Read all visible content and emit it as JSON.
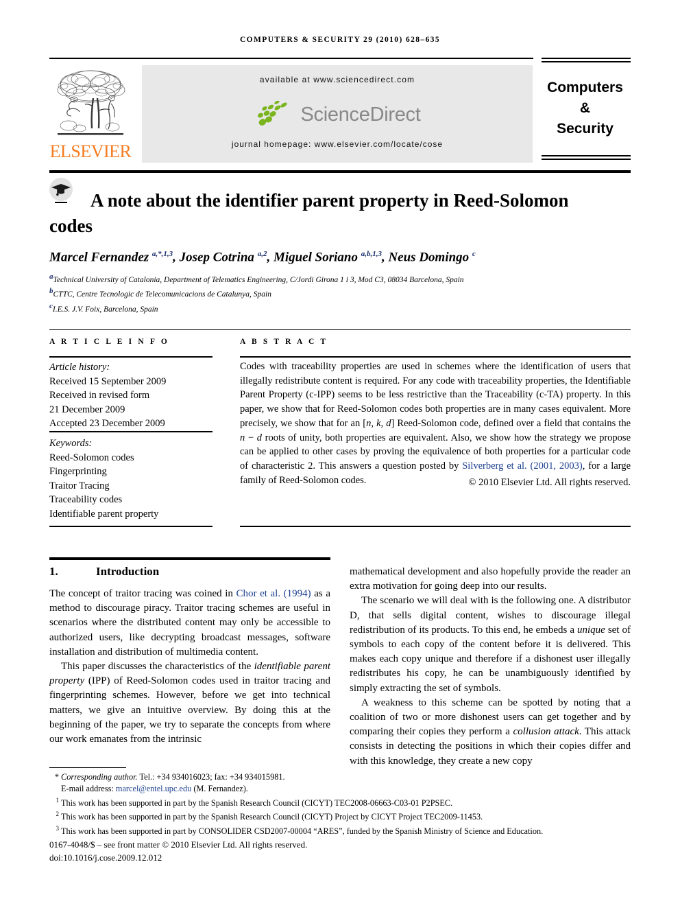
{
  "running_head": "COMPUTERS & SECURITY 29 (2010) 628–635",
  "masthead": {
    "publisher_logo_label": "ELSEVIER",
    "available_at": "available at www.sciencedirect.com",
    "sciencedirect_wordmark": "ScienceDirect",
    "journal_homepage": "journal homepage: www.elsevier.com/locate/cose",
    "journal_title_line1": "Computers",
    "journal_title_line2": "&",
    "journal_title_line3": "Security",
    "colors": {
      "elsevier_orange": "#f47b20",
      "sciencedirect_green": "#7ab51d",
      "sciencedirect_gray": "#888888",
      "band_background": "#e8e8e8"
    }
  },
  "article": {
    "title": "A note about the identifier parent property in Reed-Solomon codes",
    "authors_html": "Marcel Fernandez <sup>a,*,1,3</sup>, Josep Cotrina <sup>a,2</sup>, Miguel Soriano <sup>a,b,1,3</sup>, Neus Domingo <sup>c</sup>",
    "affiliations": [
      "Technical University of Catalonia, Department of Telematics Engineering, C/Jordi Girona 1 i 3, Mod C3, 08034 Barcelona, Spain",
      "CTTC, Centre Tecnologic de Telecomunicacions de Catalunya, Spain",
      "I.E.S. J.V. Foix, Barcelona, Spain"
    ],
    "affiliation_marks": [
      "a",
      "b",
      "c"
    ]
  },
  "article_info": {
    "label": "A R T I C L E   I N F O",
    "history_heading": "Article history:",
    "history_lines": [
      "Received 15 September 2009",
      "Received in revised form",
      "21 December 2009",
      "Accepted 23 December 2009"
    ],
    "keywords_heading": "Keywords:",
    "keywords": [
      "Reed-Solomon codes",
      "Fingerprinting",
      "Traitor Tracing",
      "Traceability codes",
      "Identifiable parent property"
    ]
  },
  "abstract": {
    "label": "A B S T R A C T",
    "text_html": "Codes with traceability properties are used in schemes where the identification of users that illegally redistribute content is required. For any code with traceability properties, the Identifiable Parent Property (c-IPP) seems to be less restrictive than the Traceability (c-TA) property. In this paper, we show that for Reed-Solomon codes both properties are in many cases equivalent. More precisely, we show that for an [<i>n</i>, <i>k</i>, <i>d</i>] Reed-Solomon code, defined over a field that contains the <i>n</i> &minus; <i>d</i> roots of unity, both properties are equivalent. Also, we show how the strategy we propose can be applied to other cases by proving the equivalence of both properties for a particular code of characteristic 2. This answers a question posted by <span class=\"lnk\">Silverberg et al. (2001, 2003)</span>, for a large family of Reed-Solomon codes.",
    "copyright": "© 2010 Elsevier Ltd. All rights reserved."
  },
  "body": {
    "section_number": "1.",
    "section_title": "Introduction",
    "left_column_html": "<p>The concept of traitor tracing was coined in <span class=\"lnk\">Chor et al. (1994)</span> as a method to discourage piracy. Traitor tracing schemes are useful in scenarios where the distributed content may only be accessible to authorized users, like decrypting broadcast messages, software installation and distribution of multimedia content.</p><p>This paper discusses the characteristics of the <i>identifiable parent property</i> (IPP) of Reed-Solomon codes used in traitor tracing and fingerprinting schemes. However, before we get into technical matters, we give an intuitive overview. By doing this at the beginning of the paper, we try to separate the concepts from where our work emanates from the intrinsic</p>",
    "right_column_html": "<p>mathematical development and also hopefully provide the reader an extra motivation for going deep into our results.</p><p>The scenario we will deal with is the following one. A distributor D, that sells digital content, wishes to discourage illegal redistribution of its products. To this end, he embeds a <i>unique</i> set of symbols to each copy of the content before it is delivered. This makes each copy unique and therefore if a dishonest user illegally redistributes his copy, he can be unambiguously identified by simply extracting the set of symbols.</p><p>A weakness to this scheme can be spotted by noting that a coalition of two or more dishonest users can get together and by comparing their copies they perform a <i>collusion attack</i>. This attack consists in detecting the positions in which their copies differ and with this knowledge, they create a new copy</p>"
  },
  "footnotes": {
    "corresponding_mark": "*",
    "corresponding_html": "<i>Corresponding author.</i> Tel.: +34 934016023; fax: +34 934015981.",
    "email_label": "E-mail address:",
    "email": "marcel@entel.upc.edu",
    "email_owner": "(M. Fernandez).",
    "numbered": [
      {
        "mark": "1",
        "text": "This work has been supported in part by the Spanish Research Council (CICYT) TEC2008-06663-C03-01 P2PSEC."
      },
      {
        "mark": "2",
        "text": "This work has been supported in part by the Spanish Research Council (CICYT) Project by CICYT Project TEC2009-11453."
      },
      {
        "mark": "3",
        "text": "This work has been supported in part by CONSOLIDER CSD2007-00004 “ARES”, funded by the Spanish Ministry of Science and Education."
      }
    ]
  },
  "imprint": {
    "line1": "0167-4048/$ – see front matter © 2010 Elsevier Ltd. All rights reserved.",
    "line2": "doi:10.1016/j.cose.2009.12.012"
  }
}
